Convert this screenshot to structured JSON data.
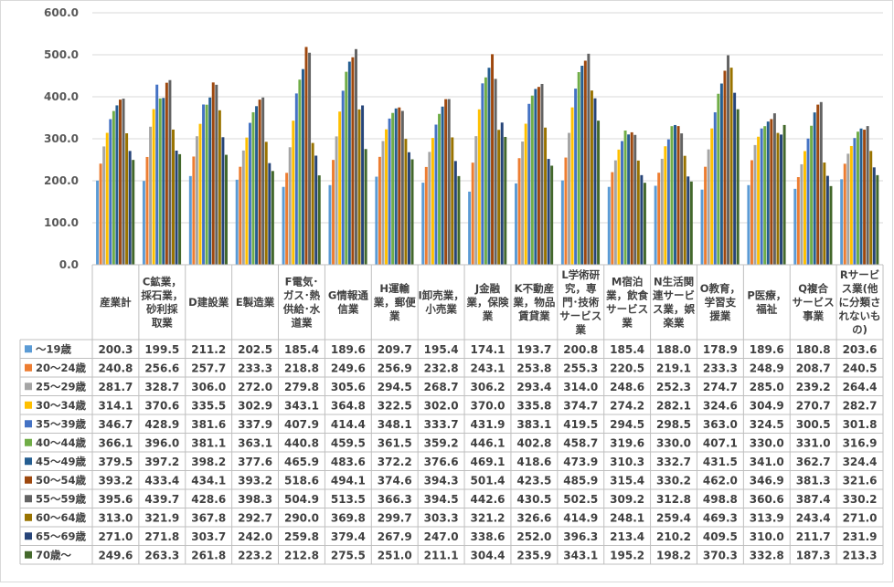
{
  "chart_data": {
    "type": "bar",
    "ylim": [
      0,
      600
    ],
    "yticks": [
      "0.0",
      "100.0",
      "200.0",
      "300.0",
      "400.0",
      "500.0",
      "600.0"
    ],
    "grid": true,
    "categories": [
      "産業計",
      "C鉱業，採石業，砂利採取業",
      "D建設業",
      "E製造業",
      "F電気･ガス･熱供給･水道業",
      "G情報通信業",
      "H運輸業，郵便業",
      "I卸売業，小売業",
      "J金融業，保険業",
      "K不動産業，物品賃貸業",
      "L学術研究，専門･技術サービス業",
      "M宿泊業，飲食サービス業",
      "N生活関連サービス業，娯楽業",
      "O教育，学習支援業",
      "P医療，福祉",
      "Q複合サービス事業",
      "Rサービス業(他に分類されないもの)"
    ],
    "category_lines": [
      [
        "産業計"
      ],
      [
        "C鉱業，",
        "採石業，",
        "砂利採",
        "取業"
      ],
      [
        "D建設業"
      ],
      [
        "E製造業"
      ],
      [
        "F電気･",
        "ガス･熱",
        "供給･水",
        "道業"
      ],
      [
        "G情報通",
        "信業"
      ],
      [
        "H運輸",
        "業，郵便",
        "業"
      ],
      [
        "I卸売業，",
        "小売業"
      ],
      [
        "J金融",
        "業，保険",
        "業"
      ],
      [
        "K不動産",
        "業，物品",
        "賃貸業"
      ],
      [
        "L学術研",
        "究，専",
        "門･技術",
        "サービス",
        "業"
      ],
      [
        "M宿泊",
        "業，飲食",
        "サービス",
        "業"
      ],
      [
        "N生活関",
        "連サービ",
        "ス業，娯",
        "楽業"
      ],
      [
        "O教育，",
        "学習支",
        "援業"
      ],
      [
        "P医療，",
        "福祉"
      ],
      [
        "Q複合",
        "サービス",
        "事業"
      ],
      [
        "Rサービ",
        "ス業(他",
        "に分類さ",
        "れないも",
        "の)"
      ]
    ],
    "series": [
      {
        "name": "～19歳",
        "color": "#5B9BD5",
        "values": [
          "200.3",
          "199.5",
          "211.2",
          "202.5",
          "185.4",
          "189.6",
          "209.7",
          "195.4",
          "174.1",
          "193.7",
          "200.8",
          "185.4",
          "188.0",
          "178.9",
          "189.6",
          "180.8",
          "203.6"
        ]
      },
      {
        "name": "20～24歳",
        "color": "#ED7D31",
        "values": [
          "240.8",
          "256.6",
          "257.7",
          "233.3",
          "218.8",
          "249.6",
          "256.9",
          "232.8",
          "243.1",
          "253.8",
          "255.3",
          "220.5",
          "219.1",
          "233.3",
          "248.9",
          "208.7",
          "240.5"
        ]
      },
      {
        "name": "25～29歳",
        "color": "#A5A5A5",
        "values": [
          "281.7",
          "328.7",
          "306.0",
          "272.0",
          "279.8",
          "305.6",
          "294.5",
          "268.7",
          "306.2",
          "293.4",
          "314.0",
          "248.6",
          "252.3",
          "274.7",
          "285.0",
          "239.2",
          "264.4"
        ]
      },
      {
        "name": "30～34歳",
        "color": "#FFC000",
        "values": [
          "314.1",
          "370.6",
          "335.5",
          "302.9",
          "343.1",
          "364.8",
          "322.5",
          "302.0",
          "370.0",
          "335.8",
          "374.7",
          "274.2",
          "282.1",
          "324.6",
          "304.9",
          "270.7",
          "282.7"
        ]
      },
      {
        "name": "35～39歳",
        "color": "#4472C4",
        "values": [
          "346.7",
          "428.9",
          "381.6",
          "337.9",
          "407.9",
          "414.4",
          "348.1",
          "333.7",
          "431.9",
          "383.1",
          "419.5",
          "294.5",
          "298.5",
          "363.0",
          "324.5",
          "300.5",
          "301.8"
        ]
      },
      {
        "name": "40～44歳",
        "color": "#70AD47",
        "values": [
          "366.1",
          "396.0",
          "381.1",
          "363.1",
          "440.8",
          "459.5",
          "361.5",
          "359.2",
          "446.1",
          "402.8",
          "458.7",
          "319.6",
          "330.0",
          "407.1",
          "330.0",
          "331.0",
          "316.9"
        ]
      },
      {
        "name": "45～49歳",
        "color": "#255E91",
        "values": [
          "379.5",
          "397.2",
          "398.2",
          "377.6",
          "465.9",
          "483.6",
          "372.2",
          "376.6",
          "469.1",
          "418.6",
          "473.9",
          "310.3",
          "332.7",
          "431.5",
          "341.0",
          "362.7",
          "324.4"
        ]
      },
      {
        "name": "50～54歳",
        "color": "#9E480E",
        "values": [
          "393.2",
          "433.4",
          "434.1",
          "393.2",
          "518.6",
          "494.1",
          "374.6",
          "394.3",
          "501.4",
          "423.5",
          "485.9",
          "315.4",
          "330.2",
          "462.0",
          "346.9",
          "381.3",
          "321.6"
        ]
      },
      {
        "name": "55～59歳",
        "color": "#636363",
        "values": [
          "395.6",
          "439.7",
          "428.6",
          "398.3",
          "504.9",
          "513.5",
          "366.3",
          "394.5",
          "442.6",
          "430.5",
          "502.5",
          "309.2",
          "312.8",
          "498.8",
          "360.6",
          "387.4",
          "330.2"
        ]
      },
      {
        "name": "60～64歳",
        "color": "#997300",
        "values": [
          "313.0",
          "321.9",
          "367.8",
          "292.7",
          "290.0",
          "369.8",
          "299.7",
          "303.3",
          "321.2",
          "326.6",
          "414.9",
          "248.1",
          "259.4",
          "469.3",
          "313.9",
          "243.4",
          "271.0"
        ]
      },
      {
        "name": "65～69歳",
        "color": "#264478",
        "values": [
          "271.0",
          "271.8",
          "303.7",
          "242.0",
          "259.8",
          "379.4",
          "267.9",
          "247.0",
          "338.6",
          "252.0",
          "396.3",
          "213.4",
          "210.2",
          "409.5",
          "310.0",
          "211.7",
          "231.9"
        ]
      },
      {
        "name": "70歳～",
        "color": "#43682B",
        "values": [
          "249.6",
          "263.3",
          "261.8",
          "223.2",
          "212.8",
          "275.5",
          "251.0",
          "211.1",
          "304.4",
          "235.9",
          "343.1",
          "195.2",
          "198.2",
          "370.3",
          "332.8",
          "187.3",
          "213.3"
        ]
      }
    ]
  }
}
